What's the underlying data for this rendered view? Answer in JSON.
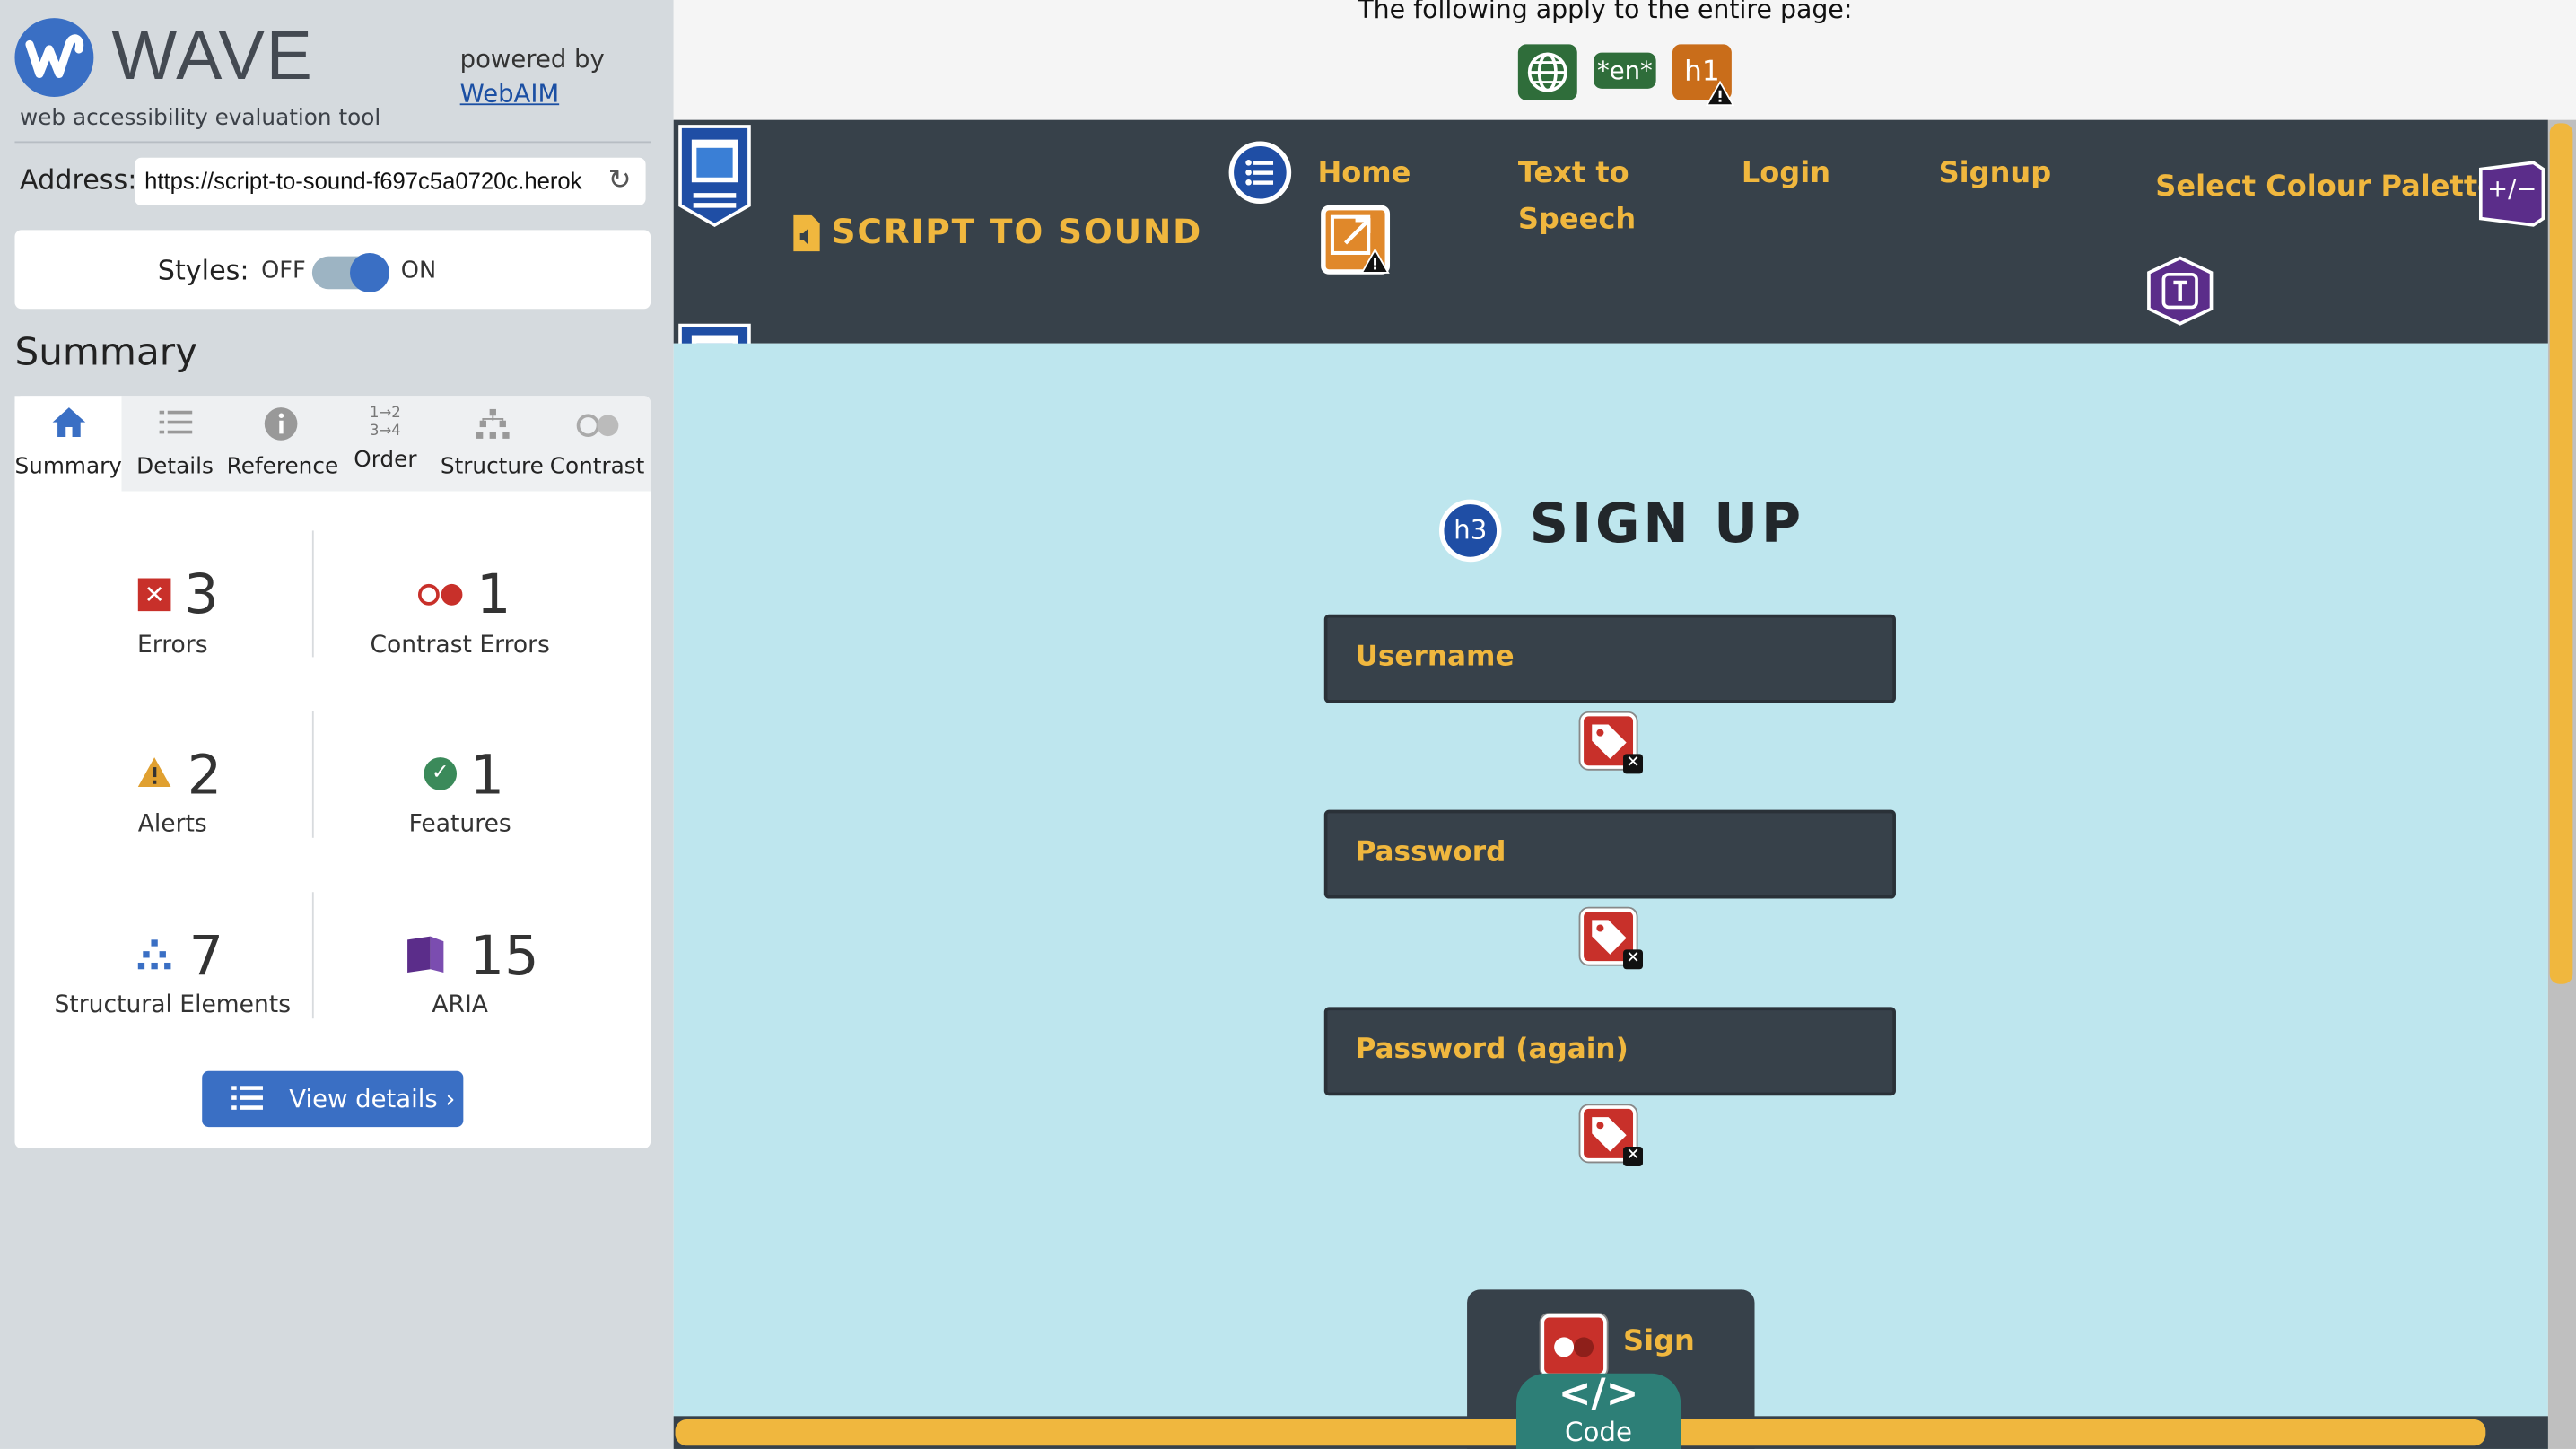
{
  "wave": {
    "logo_word": "WAVE",
    "tagline": "web accessibility evaluation tool",
    "powered_by": "powered by",
    "powered_link": "WebAIM",
    "address_label": "Address:",
    "address_value": "https://script-to-sound-f697c5a0720c.herok",
    "styles_label": "Styles:",
    "styles_off": "OFF",
    "styles_on": "ON",
    "summary_heading": "Summary",
    "tabs": [
      {
        "label": "Summary",
        "icon": "home-icon",
        "active": true
      },
      {
        "label": "Details",
        "icon": "list-icon"
      },
      {
        "label": "Reference",
        "icon": "info-icon"
      },
      {
        "label": "Order",
        "icon": "order-icon"
      },
      {
        "label": "Structure",
        "icon": "structure-icon"
      },
      {
        "label": "Contrast",
        "icon": "contrast-icon"
      }
    ],
    "stats": {
      "errors": {
        "count": "3",
        "label": "Errors"
      },
      "contrast_errors": {
        "count": "1",
        "label": "Contrast Errors"
      },
      "alerts": {
        "count": "2",
        "label": "Alerts"
      },
      "features": {
        "count": "1",
        "label": "Features"
      },
      "structural": {
        "count": "7",
        "label": "Structural Elements"
      },
      "aria": {
        "count": "15",
        "label": "ARIA"
      }
    },
    "view_details": "View details ›",
    "colors": {
      "accent": "#3a6fc4",
      "error": "#c8302a",
      "alert": "#e0a030",
      "feature": "#3b8a5a",
      "aria": "#5b2d8a"
    }
  },
  "page_note": {
    "text": "The following apply to the entire page:",
    "badges": [
      {
        "icon": "globe-icon",
        "text": ""
      },
      {
        "icon": "language-icon",
        "text": "*en*"
      },
      {
        "icon": "heading-alert-icon",
        "text": "h1"
      }
    ]
  },
  "site": {
    "brand": "SCRIPT TO SOUND",
    "nav": {
      "home": "Home",
      "tts_line1": "Text to",
      "tts_line2": "Speech",
      "login": "Login",
      "signup": "Signup",
      "palette": "Select Colour Palette",
      "palette_toggle": "+/−"
    },
    "form": {
      "heading_badge": "h3",
      "title": "SIGN UP",
      "username": "Username",
      "password": "Password",
      "password_again": "Password (again)",
      "submit": "Sign"
    },
    "code_tab": "Code",
    "code_icon": "</>",
    "colors": {
      "header_bg": "#37414a",
      "main_bg": "#bee6ee",
      "accent": "#f0b73e"
    }
  }
}
